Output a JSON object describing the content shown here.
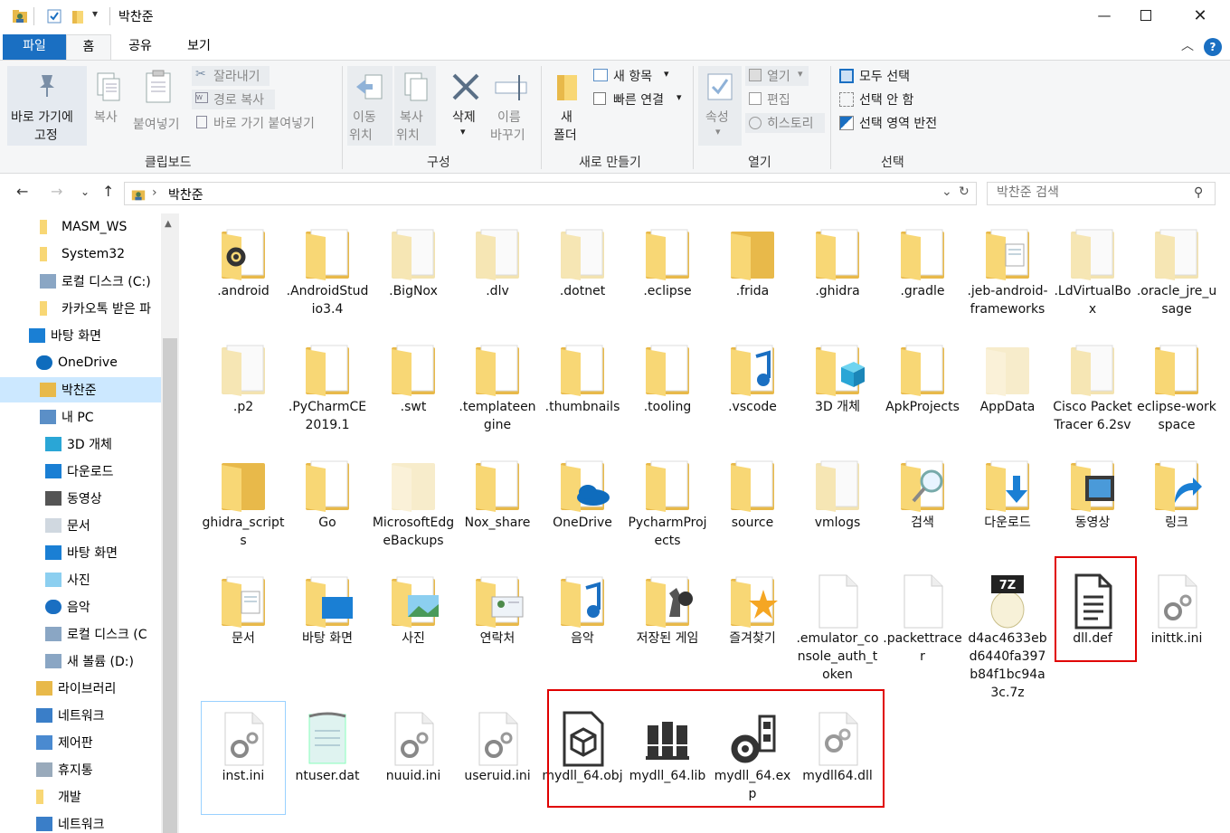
{
  "window": {
    "title": "박찬준",
    "controls": [
      "minimize",
      "maximize",
      "close"
    ]
  },
  "ribbon_tabs": [
    "파일",
    "홈",
    "공유",
    "보기"
  ],
  "ribbon": {
    "clipboard": {
      "pin_label_1": "바로 가기에",
      "pin_label_2": "고정",
      "copy": "복사",
      "paste": "붙여넣기",
      "cut": "잘라내기",
      "copy_path": "경로 복사",
      "paste_shortcut": "바로 가기 붙여넣기",
      "group": "클립보드"
    },
    "organize": {
      "move_1": "이동",
      "move_2": "위치",
      "copy_1": "복사",
      "copy_2": "위치",
      "delete": "삭제",
      "rename_1": "이름",
      "rename_2": "바꾸기",
      "group": "구성"
    },
    "new": {
      "new_folder_1": "새",
      "new_folder_2": "폴더",
      "new_item": "새 항목",
      "easy_access": "빠른 연결",
      "group": "새로 만들기"
    },
    "open": {
      "properties": "속성",
      "open": "열기",
      "edit": "편집",
      "history": "히스토리",
      "group": "열기"
    },
    "select": {
      "select_all": "모두 선택",
      "select_none": "선택 안 함",
      "invert": "선택 영역 반전",
      "group": "선택"
    }
  },
  "address": {
    "path": "박찬준",
    "search_placeholder": "박찬준 검색"
  },
  "sidebar": [
    {
      "label": "MASM_WS",
      "icon": "folder-icon"
    },
    {
      "label": "System32",
      "icon": "folder-icon"
    },
    {
      "label": "로컬 디스크 (C:)",
      "icon": "drive-icon"
    },
    {
      "label": "카카오톡 받은 파",
      "icon": "folder-icon"
    },
    {
      "label": "바탕 화면",
      "icon": "desktop-icon"
    },
    {
      "label": "OneDrive",
      "icon": "cloud-icon"
    },
    {
      "label": "박찬준",
      "icon": "user-folder-icon",
      "selected": true
    },
    {
      "label": "내 PC",
      "icon": "pc-icon"
    },
    {
      "label": "3D 개체",
      "icon": "cube-icon"
    },
    {
      "label": "다운로드",
      "icon": "download-icon"
    },
    {
      "label": "동영상",
      "icon": "video-icon"
    },
    {
      "label": "문서",
      "icon": "document-icon"
    },
    {
      "label": "바탕 화면",
      "icon": "desktop-icon"
    },
    {
      "label": "사진",
      "icon": "picture-icon"
    },
    {
      "label": "음악",
      "icon": "music-icon"
    },
    {
      "label": "로컬 디스크 (C",
      "icon": "drive-icon"
    },
    {
      "label": "새 볼륨 (D:)",
      "icon": "drive-icon"
    },
    {
      "label": "라이브러리",
      "icon": "library-icon"
    },
    {
      "label": "네트워크",
      "icon": "network-icon"
    },
    {
      "label": "제어판",
      "icon": "control-panel-icon"
    },
    {
      "label": "휴지통",
      "icon": "recycle-bin-icon"
    },
    {
      "label": "개발",
      "icon": "folder-icon"
    },
    {
      "label": "네트워크",
      "icon": "network-icon"
    }
  ],
  "files": [
    {
      "name": ".android",
      "type": "folder-gear"
    },
    {
      "name": ".AndroidStudio3.4",
      "type": "folder"
    },
    {
      "name": ".BigNox",
      "type": "folder-empty"
    },
    {
      "name": ".dlv",
      "type": "folder-empty"
    },
    {
      "name": ".dotnet",
      "type": "folder-empty"
    },
    {
      "name": ".eclipse",
      "type": "folder"
    },
    {
      "name": ".frida",
      "type": "folder-plain"
    },
    {
      "name": ".ghidra",
      "type": "folder"
    },
    {
      "name": ".gradle",
      "type": "folder"
    },
    {
      "name": ".jeb-android-frameworks",
      "type": "folder-doc"
    },
    {
      "name": ".LdVirtualBox",
      "type": "folder-empty"
    },
    {
      "name": ".oracle_jre_usage",
      "type": "folder-empty"
    },
    {
      "name": ".p2",
      "type": "folder-empty"
    },
    {
      "name": ".PyCharmCE2019.1",
      "type": "folder"
    },
    {
      "name": ".swt",
      "type": "folder"
    },
    {
      "name": ".templateengine",
      "type": "folder"
    },
    {
      "name": ".thumbnails",
      "type": "folder"
    },
    {
      "name": ".tooling",
      "type": "folder"
    },
    {
      "name": ".vscode",
      "type": "folder-music"
    },
    {
      "name": "3D 개체",
      "type": "folder-3d"
    },
    {
      "name": "ApkProjects",
      "type": "folder"
    },
    {
      "name": "AppData",
      "type": "folder-faded"
    },
    {
      "name": "Cisco Packet Tracer 6.2sv",
      "type": "folder-empty"
    },
    {
      "name": "eclipse-workspace",
      "type": "folder"
    },
    {
      "name": "ghidra_scripts",
      "type": "folder-plain"
    },
    {
      "name": "Go",
      "type": "folder"
    },
    {
      "name": "MicrosoftEdgeBackups",
      "type": "folder-faded"
    },
    {
      "name": "Nox_share",
      "type": "folder"
    },
    {
      "name": "OneDrive",
      "type": "folder-cloud"
    },
    {
      "name": "PycharmProjects",
      "type": "folder"
    },
    {
      "name": "source",
      "type": "folder"
    },
    {
      "name": "vmlogs",
      "type": "folder-empty"
    },
    {
      "name": "검색",
      "type": "folder-search"
    },
    {
      "name": "다운로드",
      "type": "folder-download"
    },
    {
      "name": "동영상",
      "type": "folder-video"
    },
    {
      "name": "링크",
      "type": "folder-link"
    },
    {
      "name": "문서",
      "type": "folder-doc"
    },
    {
      "name": "바탕 화면",
      "type": "folder-desktop"
    },
    {
      "name": "사진",
      "type": "folder-picture"
    },
    {
      "name": "연락처",
      "type": "folder-contact"
    },
    {
      "name": "음악",
      "type": "folder-music"
    },
    {
      "name": "저장된 게임",
      "type": "folder-game"
    },
    {
      "name": "즐겨찾기",
      "type": "folder-star"
    },
    {
      "name": ".emulator_console_auth_token",
      "type": "file-blank"
    },
    {
      "name": ".packettracer",
      "type": "file-blank"
    },
    {
      "name": "d4ac4633ebd6440fa397b84f1bc94a3c.7z",
      "type": "file-7z"
    },
    {
      "name": "dll.def",
      "type": "file-text"
    },
    {
      "name": "inittk.ini",
      "type": "file-ini"
    },
    {
      "name": "inst.ini",
      "type": "file-ini"
    },
    {
      "name": "ntuser.dat",
      "type": "file-notepad"
    },
    {
      "name": "nuuid.ini",
      "type": "file-ini"
    },
    {
      "name": "useruid.ini",
      "type": "file-ini"
    },
    {
      "name": "mydll_64.obj",
      "type": "file-obj"
    },
    {
      "name": "mydll_64.lib",
      "type": "file-lib"
    },
    {
      "name": "mydll_64.exp",
      "type": "file-exp"
    },
    {
      "name": "mydll64.dll",
      "type": "file-dll"
    }
  ],
  "colors": {
    "accent": "#1a6fc2",
    "folder": "#f8d775",
    "folder_dark": "#e8b94a",
    "selection": "#cce8ff",
    "highlight": "#e00000"
  }
}
